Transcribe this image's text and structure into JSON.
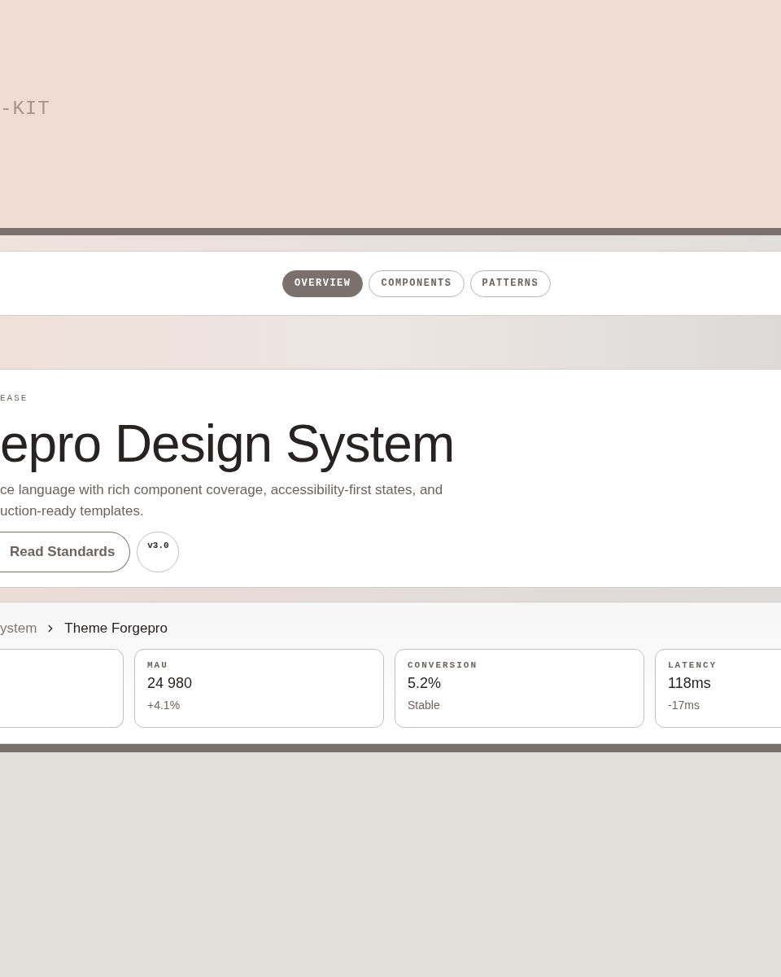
{
  "banner": {
    "label": "-KIT"
  },
  "nav": {
    "tabs": [
      {
        "label": "OVERVIEW",
        "selected": true
      },
      {
        "label": "COMPONENTS",
        "selected": false
      },
      {
        "label": "PATTERNS",
        "selected": false
      }
    ]
  },
  "hero": {
    "eyebrow": "EASE",
    "title": "epro Design System",
    "description": "ce language with rich component coverage, accessibility-first states, and uction-ready templates.",
    "button": "Read Standards",
    "version": "v3.0"
  },
  "breadcrumb": [
    "ystem",
    "Theme Forgepro"
  ],
  "stats": [
    {
      "label": "MAU",
      "value": "24 980",
      "delta": "+4.1%"
    },
    {
      "label": "CONVERSION",
      "value": "5.2%",
      "delta": "Stable"
    },
    {
      "label": "LATENCY",
      "value": "118ms",
      "delta": "-17ms"
    }
  ]
}
